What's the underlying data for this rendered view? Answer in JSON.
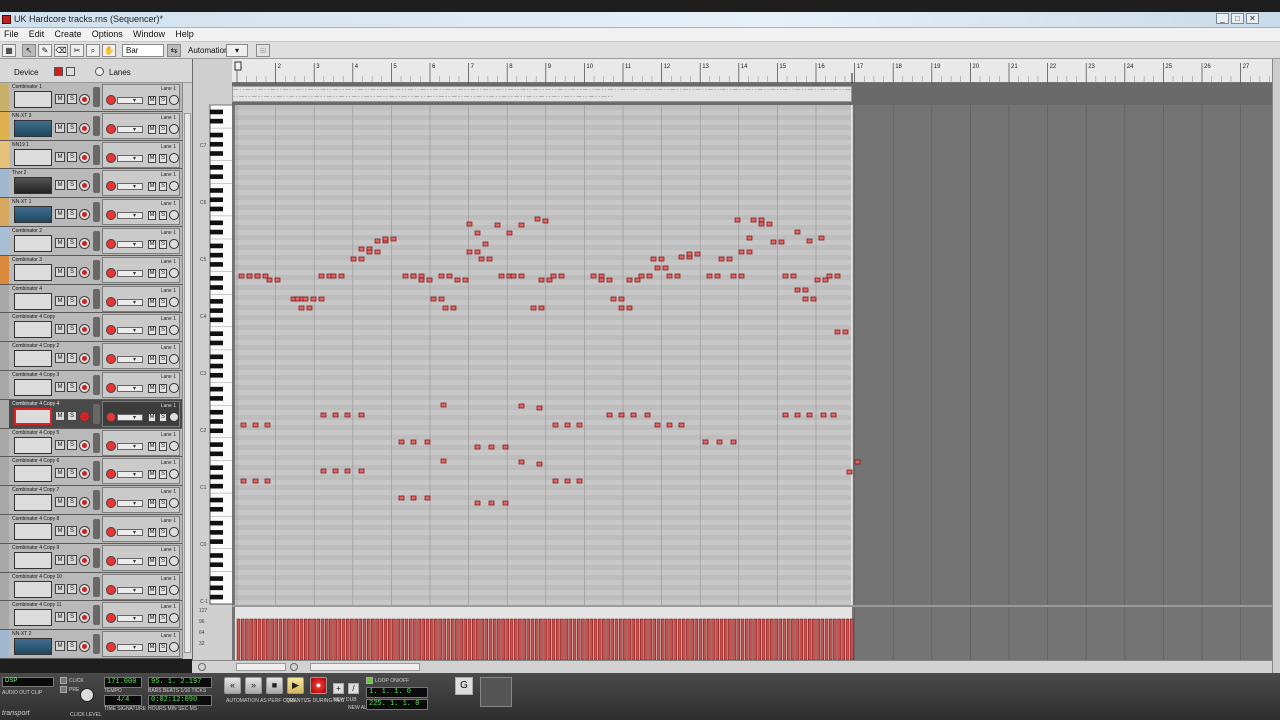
{
  "window": {
    "title": "UK Hardcore tracks.rns (Sequencer)*",
    "buttons": [
      "_",
      "□",
      "✕"
    ]
  },
  "menu": [
    "File",
    "Edit",
    "Create",
    "Options",
    "Window",
    "Help"
  ],
  "toolbar": {
    "snap_value": "Bar",
    "automation_label": "Automation:"
  },
  "track_header": {
    "device": "Device",
    "lanes": "Lanes"
  },
  "tracks": [
    {
      "name": "Combinator 1",
      "color": "#c8b16a",
      "thumb": "lite"
    },
    {
      "name": "NN-XT 3",
      "color": "#e0b050",
      "thumb": "dev"
    },
    {
      "name": "NN19 1",
      "color": "#e6c27a",
      "thumb": "lite"
    },
    {
      "name": "Thor 2",
      "color": "#9fb8cf",
      "thumb": "rack"
    },
    {
      "name": "NN-XT 1",
      "color": "#d8a860",
      "thumb": "dev"
    },
    {
      "name": "Combinator 2",
      "color": "#a6bfd6",
      "thumb": "lite"
    },
    {
      "name": "Combinator 3",
      "color": "#d8893c",
      "thumb": "lite"
    },
    {
      "name": "Combinator 4",
      "color": "#a8a8a8",
      "thumb": "lite"
    },
    {
      "name": "Combinator 4 Copy",
      "color": "#a8a8a8",
      "thumb": "lite"
    },
    {
      "name": "Combinator 4 Copy 2",
      "color": "#a8a8a8",
      "thumb": "lite"
    },
    {
      "name": "Combinator 4 Copy 3",
      "color": "#a8a8a8",
      "thumb": "lite"
    },
    {
      "name": "Combinator 4 Copy 4",
      "color": "#a8a8a8",
      "thumb": "lite",
      "selected": true
    },
    {
      "name": "Combinator 4 Copy 5",
      "color": "#a8a8a8",
      "thumb": "lite"
    },
    {
      "name": "Combinator 4 Copy 6",
      "color": "#a8a8a8",
      "thumb": "lite"
    },
    {
      "name": "Combinator 4 Copy 7",
      "color": "#a8a8a8",
      "thumb": "lite"
    },
    {
      "name": "Combinator 4 Copy 8",
      "color": "#a8a8a8",
      "thumb": "lite"
    },
    {
      "name": "Combinator 4 Copy 9",
      "color": "#a8a8a8",
      "thumb": "lite"
    },
    {
      "name": "Combinator 4 Copy 10",
      "color": "#a8a8a8",
      "thumb": "lite"
    },
    {
      "name": "Combinator 4 Copy 11",
      "color": "#a8a8a8",
      "thumb": "lite"
    },
    {
      "name": "NN-XT 2",
      "color": "#9fb8cf",
      "thumb": "dev"
    }
  ],
  "lane_label": "Lane 1",
  "ruler_bars": [
    "1",
    "2",
    "3",
    "4",
    "5",
    "6",
    "7",
    "8",
    "9",
    "10",
    "11",
    "12",
    "13",
    "14",
    "15",
    "16",
    "17",
    "18",
    "19",
    "20",
    "21",
    "22",
    "23",
    "24",
    "25",
    "26",
    "27"
  ],
  "octave_labels": [
    "C7",
    "C6",
    "C5",
    "C4",
    "C3",
    "C2",
    "C1",
    "C0",
    "C-1"
  ],
  "velocity_scale": [
    "127",
    "96",
    "64",
    "32"
  ],
  "transport": {
    "dsp_label": "DSP",
    "audio_out_clip": "AUDIO OUT CLIP",
    "click_label": "CLICK",
    "pre_label": "PRE",
    "click_level": "CLICK LEVEL",
    "tempo": "171.000",
    "tempo_label": "TEMPO",
    "time_signature": "4/4",
    "ts_label": "TIME SIGNATURE",
    "position": "95. 1. 2.197",
    "position_label": "BARS BEATS 1/16 TICKS",
    "time": "0:02:12:090",
    "time_label": "HOURS MIN SEC MS",
    "loop_label": "LOOP ON/OFF",
    "left_locator": "1. 1. 1. 0",
    "right_locator": "225. 1. 1. 0",
    "auto_label": "AUTOMATION AS PERF CTRL",
    "quantize_label": "QUANTIZE DURING REC",
    "new_dub": "NEW DUB",
    "new_alt": "NEW ALT",
    "reason_label": "transport"
  }
}
